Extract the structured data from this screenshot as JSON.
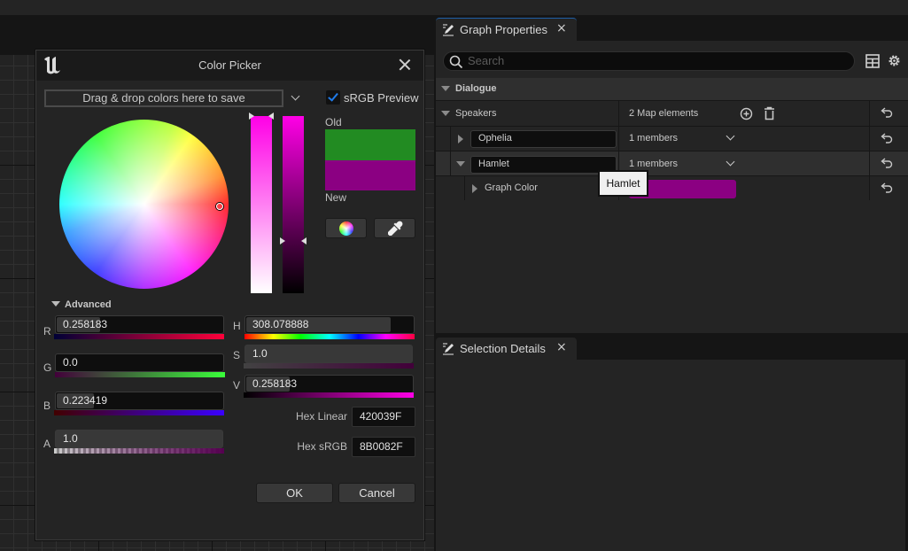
{
  "color_picker": {
    "title": "Color Picker",
    "swatch_drop_label": "Drag & drop colors here to save",
    "srgb_preview_label": "sRGB Preview",
    "srgb_preview_checked": true,
    "old_label": "Old",
    "new_label": "New",
    "old_color": "#228B22",
    "new_color": "#8B0082",
    "advanced_label": "Advanced",
    "channels": {
      "r": {
        "label": "R",
        "value": "0.258183",
        "fraction": 0.258183
      },
      "g": {
        "label": "G",
        "value": "0.0",
        "fraction": 0.0
      },
      "b": {
        "label": "B",
        "value": "0.223419",
        "fraction": 0.223419
      },
      "a": {
        "label": "A",
        "value": "1.0",
        "fraction": 1.0
      },
      "h": {
        "label": "H",
        "value": "308.078888",
        "fraction": 0.8558
      },
      "s": {
        "label": "S",
        "value": "1.0",
        "fraction": 1.0
      },
      "v": {
        "label": "V",
        "value": "0.258183",
        "fraction": 0.258183
      }
    },
    "hex_linear_label": "Hex Linear",
    "hex_linear_value": "420039F",
    "hex_srgb_label": "Hex sRGB",
    "hex_srgb_value": "8B0082F",
    "ok_label": "OK",
    "cancel_label": "Cancel",
    "icons": {
      "logo": "unreal-engine-logo",
      "close": "close-icon",
      "wheel_mode": "color-wheel-icon",
      "eyedropper": "eyedropper-icon"
    }
  },
  "graph_properties": {
    "tab_label": "Graph Properties",
    "search_placeholder": "Search",
    "category": "Dialogue",
    "rows": {
      "speakers": {
        "name": "Speakers",
        "value": "2 Map elements"
      },
      "ophelia": {
        "key": "Ophelia",
        "value": "1 members"
      },
      "hamlet": {
        "key": "Hamlet",
        "value": "1 members"
      },
      "graph_color": {
        "name": "Graph Color",
        "color": "#8B0082"
      }
    },
    "tooltip": "Hamlet"
  },
  "selection_details": {
    "tab_label": "Selection Details"
  }
}
